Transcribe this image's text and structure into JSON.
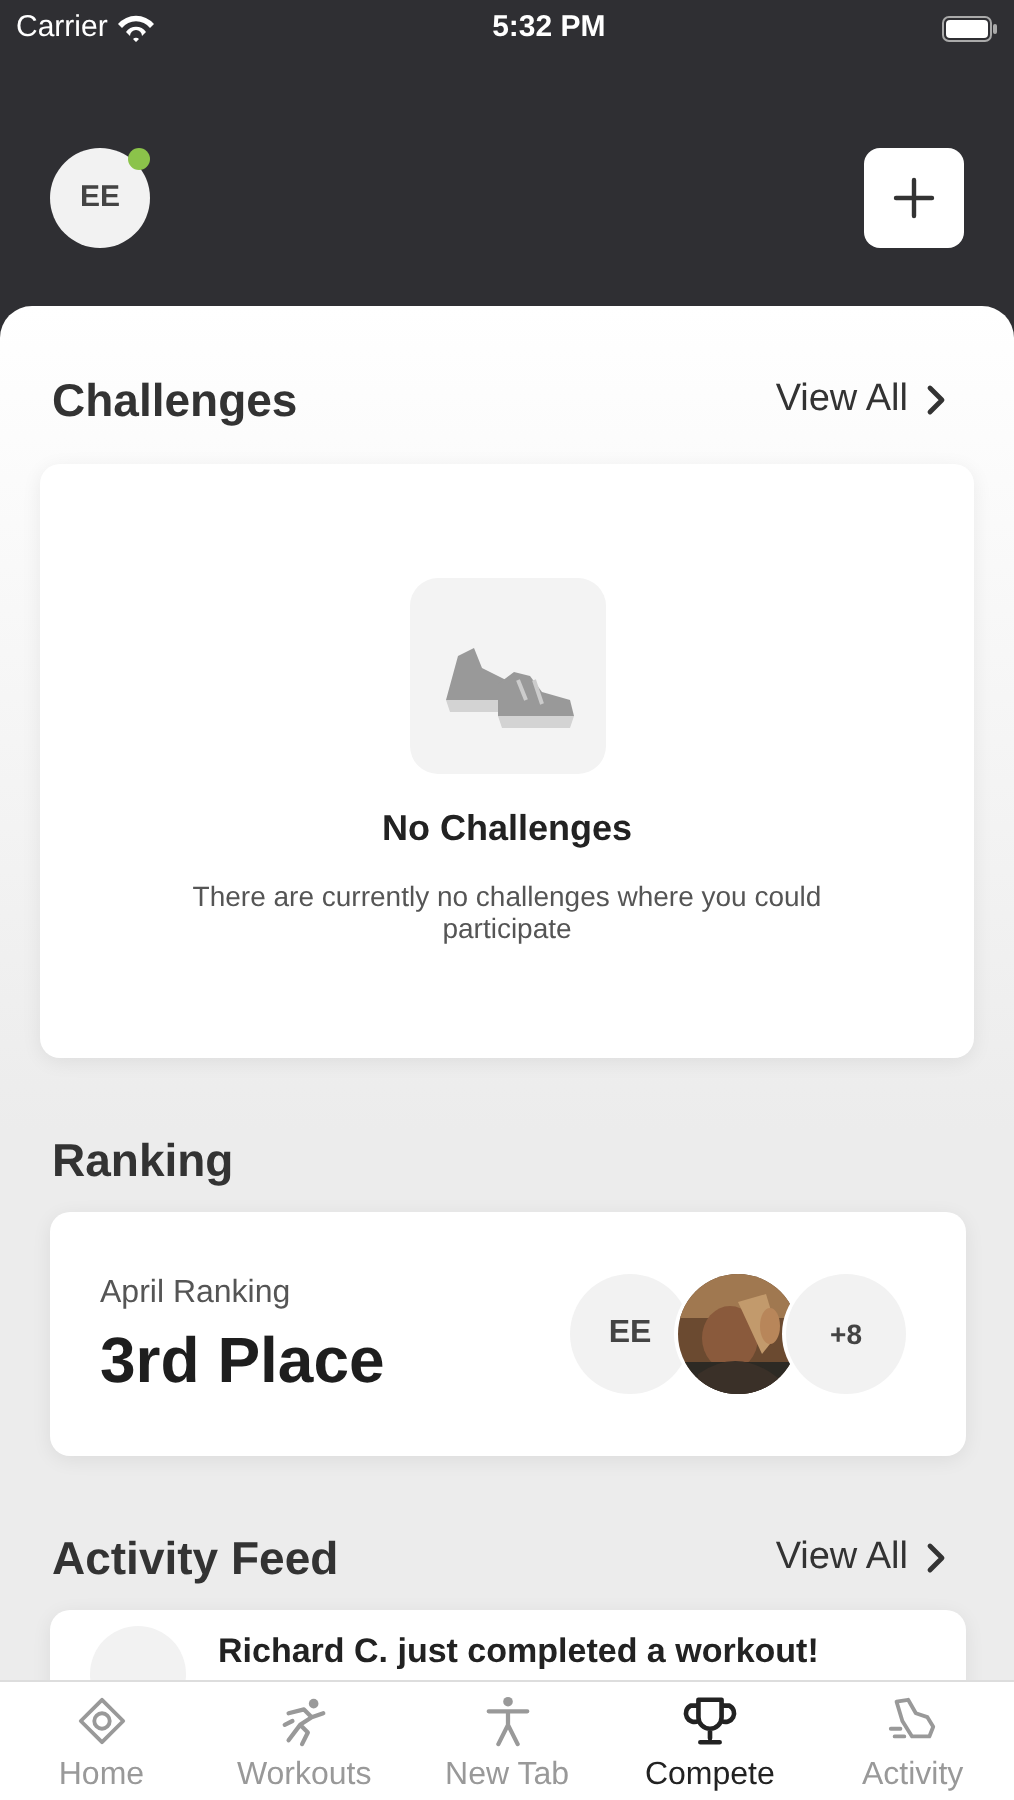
{
  "status_bar": {
    "carrier": "Carrier",
    "time": "5:32 PM"
  },
  "header": {
    "avatar": {
      "initials": "EE",
      "online": true
    }
  },
  "challenges": {
    "title": "Challenges",
    "view_all": "View All",
    "empty_title": "No Challenges",
    "empty_text": "There are currently no challenges where you could participate"
  },
  "ranking": {
    "title": "Ranking",
    "label": "April Ranking",
    "place": "3rd Place",
    "members": [
      {
        "kind": "initials",
        "text": "EE"
      },
      {
        "kind": "picture"
      },
      {
        "kind": "more",
        "text": "+8"
      }
    ]
  },
  "activity_feed": {
    "title": "Activity Feed",
    "view_all": "View All",
    "items": [
      {
        "text": "Richard C. just completed a workout!"
      }
    ]
  },
  "tabs": [
    {
      "label": "Home",
      "selected": false
    },
    {
      "label": "Workouts",
      "selected": false
    },
    {
      "label": "New Tab",
      "selected": false
    },
    {
      "label": "Compete",
      "selected": true
    },
    {
      "label": "Activity",
      "selected": false
    }
  ]
}
